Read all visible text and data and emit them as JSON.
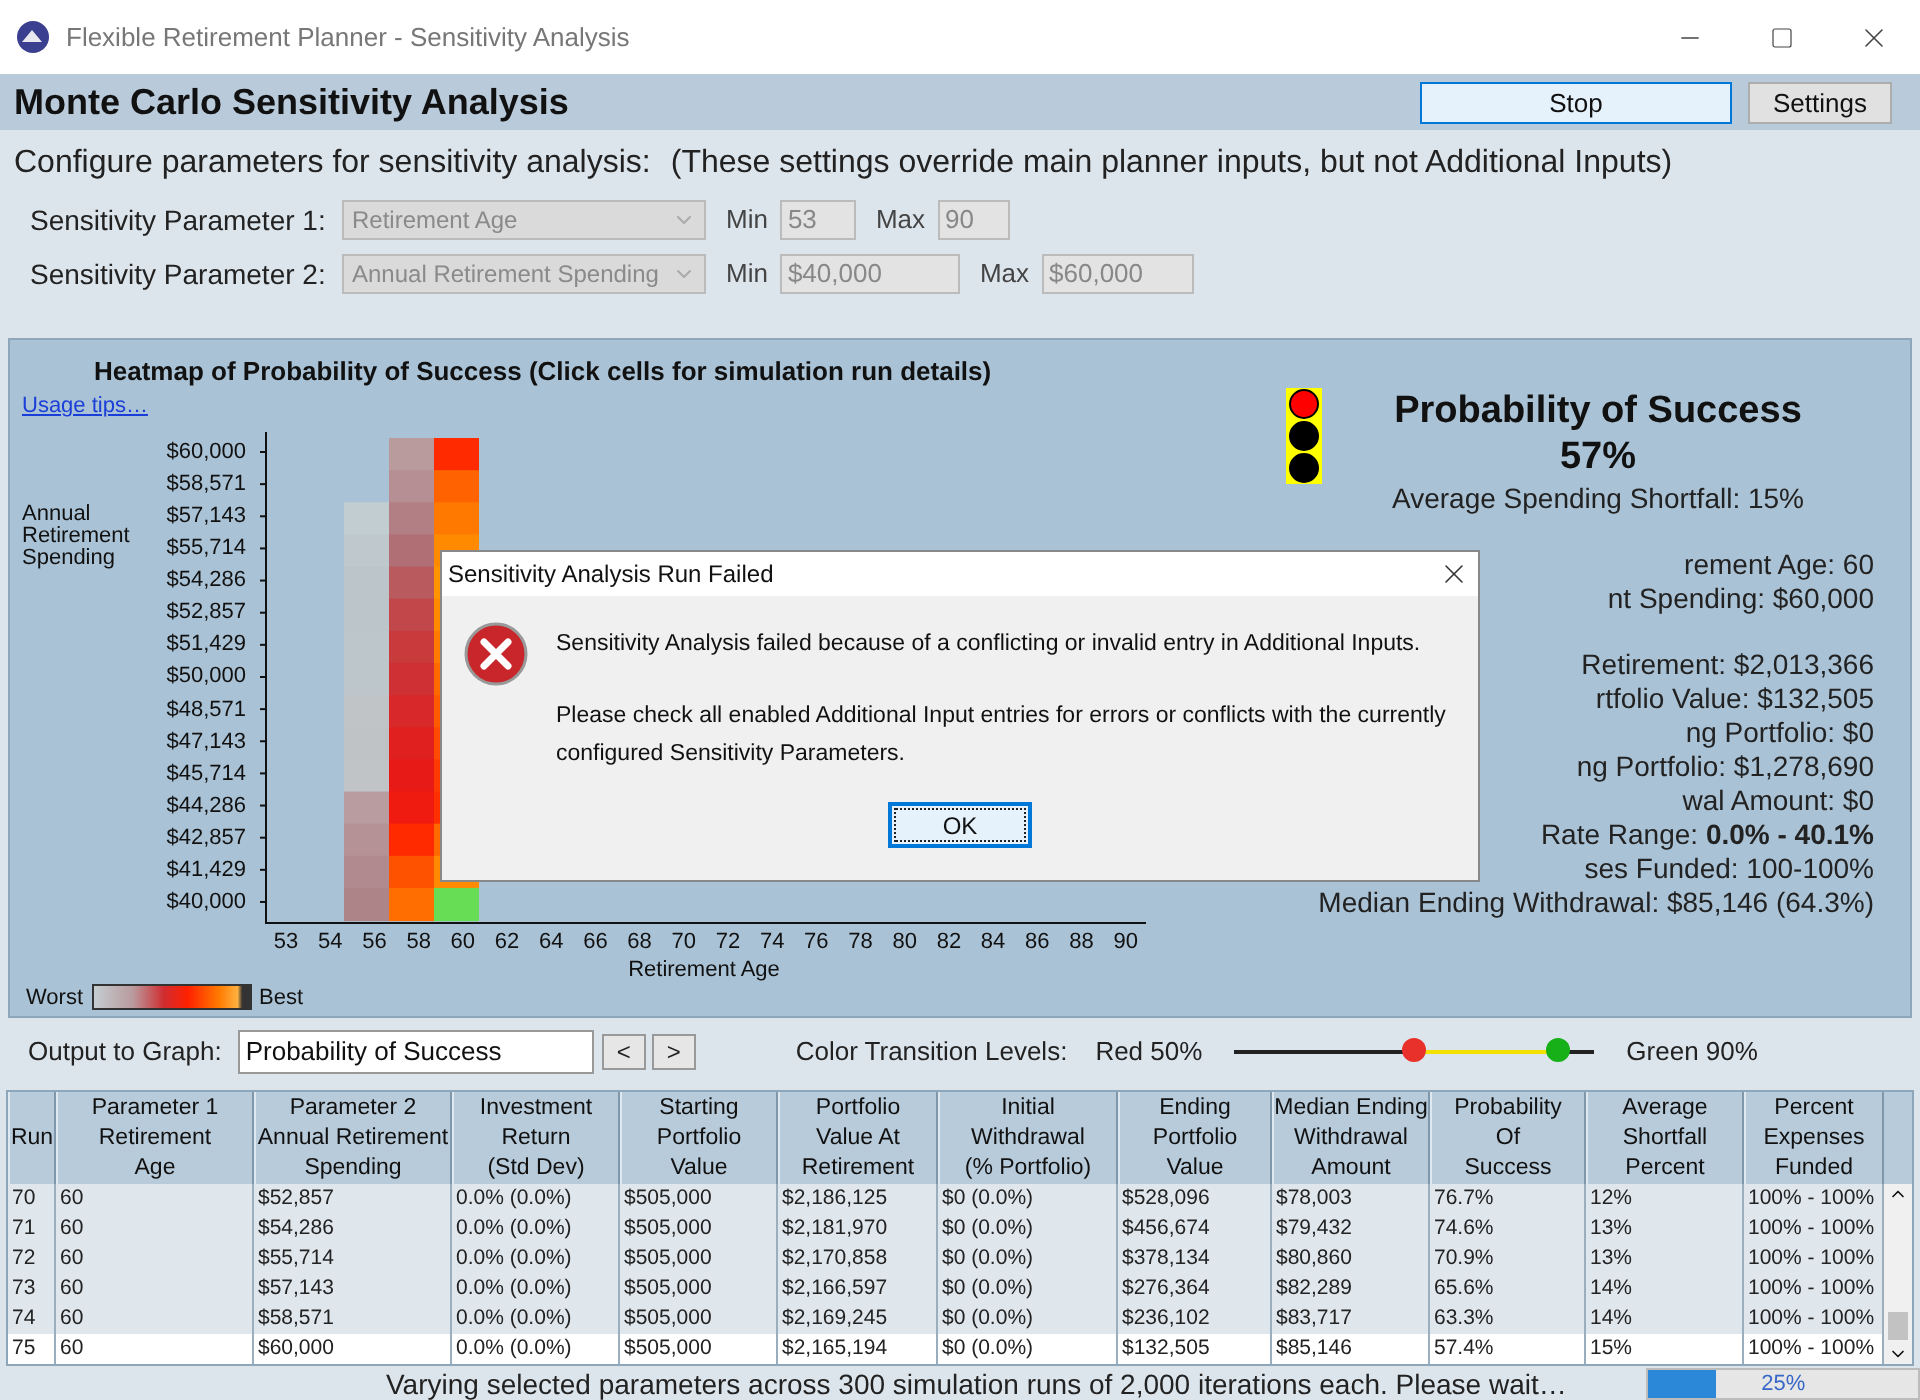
{
  "window": {
    "title": "Flexible Retirement Planner - Sensitivity Analysis"
  },
  "header": {
    "title": "Monte Carlo Sensitivity Analysis",
    "buttons": [
      {
        "label": "Stop",
        "kind": "primary"
      },
      {
        "label": "Settings",
        "kind": "normal"
      }
    ]
  },
  "config": {
    "intro": "Configure parameters for sensitivity analysis:",
    "note": "(These settings override main planner inputs, but not Additional Inputs)",
    "parameters": [
      {
        "label": "Sensitivity Parameter 1:",
        "value": "Retirement Age",
        "disabled": true,
        "min_label": "Min",
        "min": "53",
        "max_label": "Max",
        "max": "90"
      },
      {
        "label": "Sensitivity Parameter 2:",
        "value": "Annual Retirement Spending",
        "disabled": true,
        "min_label": "Min",
        "min": "$40,000",
        "max_label": "Max",
        "max": "$60,000"
      }
    ]
  },
  "heatmap": {
    "title": "Heatmap of Probability of Success (Click cells for simulation run details)",
    "link": "Usage tips…",
    "ylabel": "Annual Retirement Spending",
    "yticks": [
      "$60,000",
      "$58,571",
      "$57,143",
      "$55,714",
      "$54,286",
      "$52,857",
      "$51,429",
      "$50,000",
      "$48,571",
      "$47,143",
      "$45,714",
      "$44,286",
      "$42,857",
      "$41,429",
      "$40,000"
    ],
    "xticks": [
      "53",
      "54",
      "56",
      "58",
      "60",
      "62",
      "64",
      "66",
      "68",
      "70",
      "72",
      "74",
      "76",
      "78",
      "80",
      "82",
      "84",
      "86",
      "88",
      "90"
    ],
    "xlabel": "Retirement Age",
    "columns": [
      {
        "cells": [
          {
            "color": "#c2cdd2"
          },
          {
            "color": "#bfc9cd"
          },
          {
            "color": "#bcc6ca"
          },
          {
            "color": "#bcc6ca"
          },
          {
            "color": "#bdc6ca"
          },
          {
            "color": "#bdc6ca"
          },
          {
            "color": "#c0c4c6"
          },
          {
            "color": "#bfc3c5"
          },
          {
            "color": "#c0c4c6"
          },
          {
            "color": "#b99ca0"
          },
          {
            "color": "#b59296"
          },
          {
            "color": "#b08a8e"
          },
          {
            "color": "#ad8589"
          }
        ]
      },
      {
        "cells": [
          {
            "color": "#b99a9d"
          },
          {
            "color": "#b58f93"
          },
          {
            "color": "#b27f84"
          },
          {
            "color": "#b06f74"
          },
          {
            "color": "#b85a5e"
          },
          {
            "color": "#c2474a"
          },
          {
            "color": "#c93a3d"
          },
          {
            "color": "#cf3033"
          },
          {
            "color": "#d82829"
          },
          {
            "color": "#e0201f"
          },
          {
            "color": "#e81a17"
          },
          {
            "color": "#f01b10"
          },
          {
            "color": "#ff2a00"
          },
          {
            "color": "#ff5200"
          },
          {
            "color": "#ff6e00"
          }
        ]
      },
      {
        "cells": [
          {
            "color": "#ff2a00"
          },
          {
            "color": "#ff6200"
          },
          {
            "color": "#ff7800"
          },
          {
            "color": "#ff8a00"
          },
          {
            "color": "#ff9400"
          },
          {
            "color": "#ff8a00"
          },
          {
            "color": "#ff7a00"
          },
          {
            "color": "#ff6a00"
          },
          {
            "color": "#ff5a00"
          },
          {
            "color": "#ff4a00"
          },
          {
            "color": "#ff3a00"
          },
          {
            "color": "#ff3000"
          },
          {
            "color": "#ff6a00"
          },
          {
            "color": "#ff8a00"
          },
          {
            "color": "#66dd55"
          }
        ]
      }
    ],
    "legend": {
      "low": "Worst",
      "high": "Best"
    }
  },
  "result": {
    "lamps": [
      {
        "on": true
      },
      {
        "on": false
      },
      {
        "on": false
      }
    ],
    "title": "Probability of Success",
    "value": "57%",
    "shortfall": "Average Spending Shortfall: 15%",
    "stat_groups": [
      [
        "rement Age: 60",
        "nt Spending: $60,000"
      ],
      [
        "Retirement: $2,013,366",
        "rtfolio Value: $132,505",
        "ng Portfolio: $0",
        "ng Portfolio: $1,278,690",
        "wal Amount: $0",
        "Rate Range: **0.0% - 40.1%**",
        "ses Funded: 100-100%",
        "Median Ending Withdrawal: $85,146 (64.3%)"
      ]
    ]
  },
  "output": {
    "label": "Output to Graph:",
    "value": "Probability of Success",
    "prev": "<",
    "next": ">",
    "levels_label": "Color Transition Levels:",
    "red_label": "Red 50%",
    "green_label": "Green 90%",
    "thresholds": [
      {
        "kind": "red",
        "level": 0.5
      },
      {
        "kind": "green",
        "level": 0.9
      }
    ]
  },
  "table": {
    "columns": [
      "Run",
      "Parameter 1\nRetirement\nAge",
      "Parameter 2\nAnnual Retirement\nSpending",
      "Investment\nReturn\n(Std Dev)",
      "Starting\nPortfolio\nValue",
      "Portfolio\nValue At\nRetirement",
      "Initial\nWithdrawal\n(% Portfolio)",
      "Ending\nPortfolio\nValue",
      "Median Ending\nWithdrawal\nAmount",
      "Probability\nOf\nSuccess",
      "Average\nShortfall\nPercent",
      "Percent\nExpenses\nFunded"
    ],
    "rows": [
      {
        "selected": false,
        "cells": [
          "70",
          "60",
          "$52,857",
          "0.0% (0.0%)",
          "$505,000",
          "$2,186,125",
          "$0 (0.0%)",
          "$528,096",
          "$78,003",
          "76.7%",
          "12%",
          "100% - 100%"
        ]
      },
      {
        "selected": false,
        "cells": [
          "71",
          "60",
          "$54,286",
          "0.0% (0.0%)",
          "$505,000",
          "$2,181,970",
          "$0 (0.0%)",
          "$456,674",
          "$79,432",
          "74.6%",
          "13%",
          "100% - 100%"
        ]
      },
      {
        "selected": false,
        "cells": [
          "72",
          "60",
          "$55,714",
          "0.0% (0.0%)",
          "$505,000",
          "$2,170,858",
          "$0 (0.0%)",
          "$378,134",
          "$80,860",
          "70.9%",
          "13%",
          "100% - 100%"
        ]
      },
      {
        "selected": false,
        "cells": [
          "73",
          "60",
          "$57,143",
          "0.0% (0.0%)",
          "$505,000",
          "$2,166,597",
          "$0 (0.0%)",
          "$276,364",
          "$82,289",
          "65.6%",
          "14%",
          "100% - 100%"
        ]
      },
      {
        "selected": false,
        "cells": [
          "74",
          "60",
          "$58,571",
          "0.0% (0.0%)",
          "$505,000",
          "$2,169,245",
          "$0 (0.0%)",
          "$236,102",
          "$83,717",
          "63.3%",
          "14%",
          "100% - 100%"
        ]
      },
      {
        "selected": true,
        "cells": [
          "75",
          "60",
          "$60,000",
          "0.0% (0.0%)",
          "$505,000",
          "$2,165,194",
          "$0 (0.0%)",
          "$132,505",
          "$85,146",
          "57.4%",
          "15%",
          "100% - 100%"
        ]
      }
    ]
  },
  "status": {
    "text": "Varying selected parameters across 300 simulation runs of 2,000 iterations each.  Please wait…",
    "progress": {
      "level": 0.25,
      "label": "25%"
    }
  },
  "dialog": {
    "title": "Sensitivity Analysis Run Failed",
    "message": "Sensitivity Analysis failed because of a conflicting or invalid entry in Additional Inputs.",
    "detail": "Please check all enabled Additional Input entries for errors or conflicts with the currently configured Sensitivity Parameters.",
    "button": "OK"
  }
}
